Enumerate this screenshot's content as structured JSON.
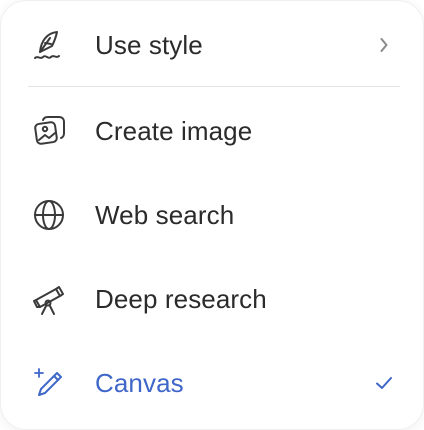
{
  "menu": {
    "items": [
      {
        "label": "Use style",
        "icon": "quill-pen-icon",
        "trailing": "chevron-right-icon",
        "selected": false
      },
      {
        "label": "Create image",
        "icon": "image-stack-icon",
        "trailing": "",
        "selected": false
      },
      {
        "label": "Web search",
        "icon": "globe-icon",
        "trailing": "",
        "selected": false
      },
      {
        "label": "Deep research",
        "icon": "telescope-icon",
        "trailing": "",
        "selected": false
      },
      {
        "label": "Canvas",
        "icon": "sparkle-pen-icon",
        "trailing": "checkmark-icon",
        "selected": true
      }
    ]
  },
  "colors": {
    "text": "#2b2b2b",
    "icon": "#3a3a3a",
    "accent": "#3f66c9",
    "muted": "#8a8a8a",
    "divider": "#e3e3e3"
  }
}
